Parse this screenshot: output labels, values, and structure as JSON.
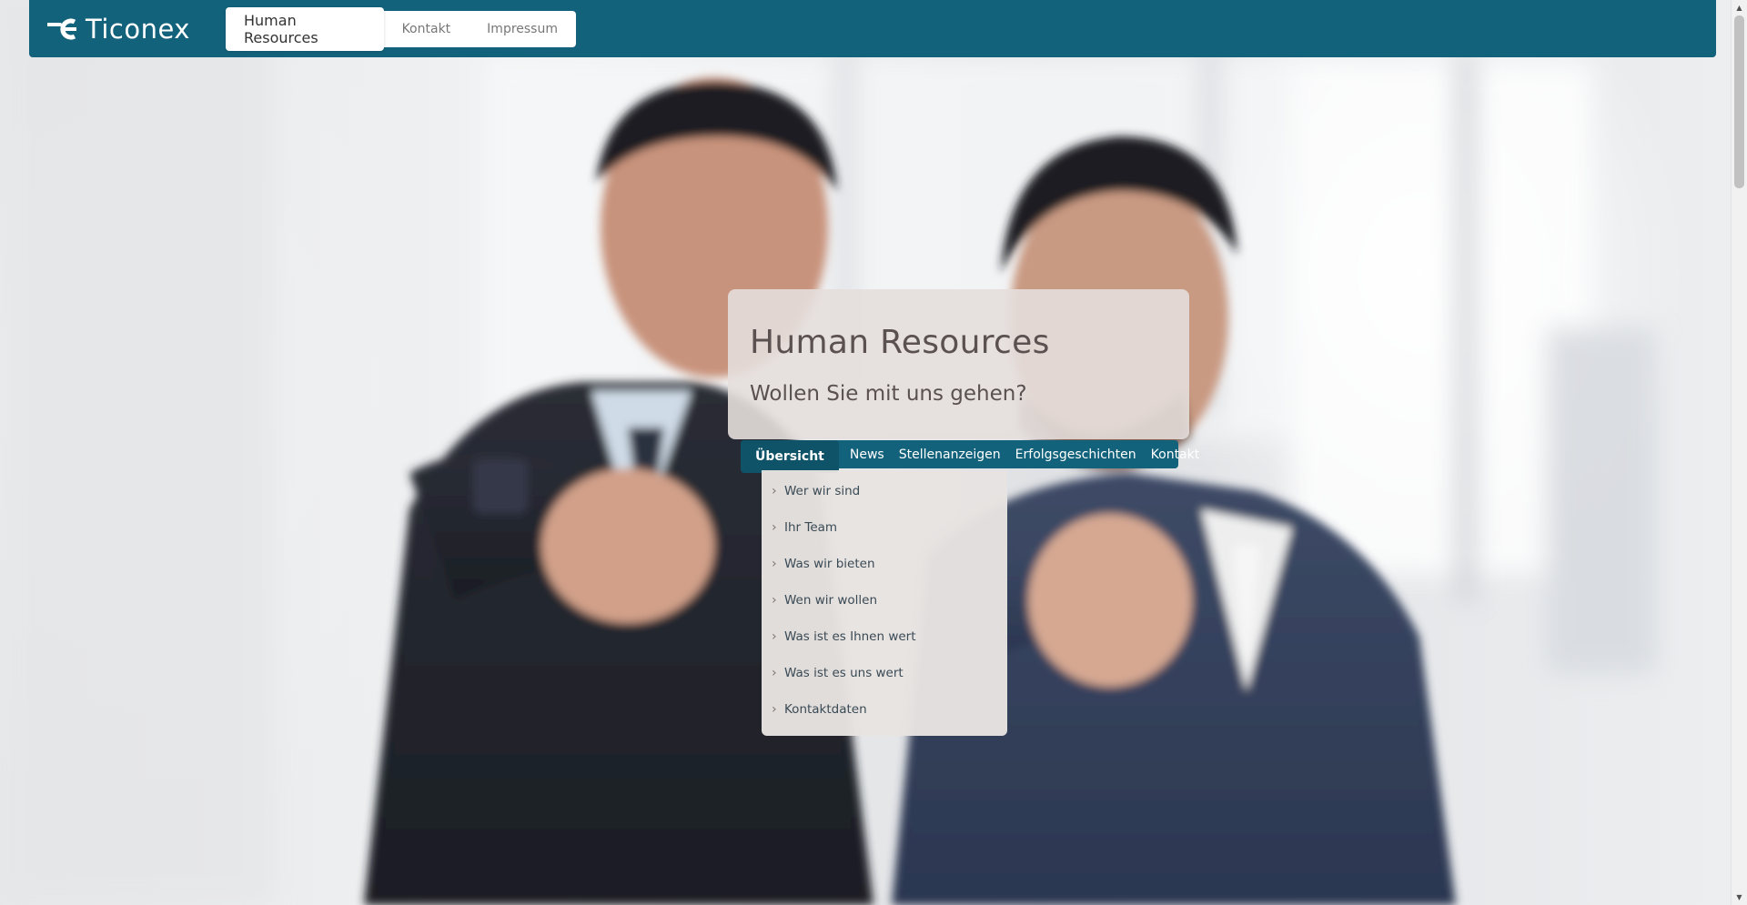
{
  "logo": {
    "text": "Ticonex",
    "icon": "ticonex-logo-mark"
  },
  "topnav": {
    "items": [
      "Human Resources",
      "Kontakt",
      "Impressum"
    ],
    "active": "Human Resources"
  },
  "hero": {
    "title": "Human Resources",
    "subtitle": "Wollen Sie mit uns gehen?"
  },
  "subnav": {
    "tabs": [
      "Übersicht",
      "News",
      "Stellenanzeigen",
      "Erfolgsgeschichten",
      "Kontakt"
    ],
    "active": "Übersicht"
  },
  "dropdown": {
    "icon": "chevron-right-icon",
    "items": [
      "Wer wir sind",
      "Ihr Team",
      "Was wir bieten",
      "Wen wir wollen",
      "Was ist es Ihnen wert",
      "Was ist es uns wert",
      "Kontaktdaten"
    ]
  },
  "colors": {
    "brand": "#13627c",
    "brand_dark": "#0f5369",
    "card_bg": "#e4dedb",
    "title_text": "#5a5150",
    "link_text": "#3a4a55"
  },
  "scrollbar": {
    "up_icon": "arrow-up-icon",
    "down_icon": "arrow-down-icon"
  }
}
